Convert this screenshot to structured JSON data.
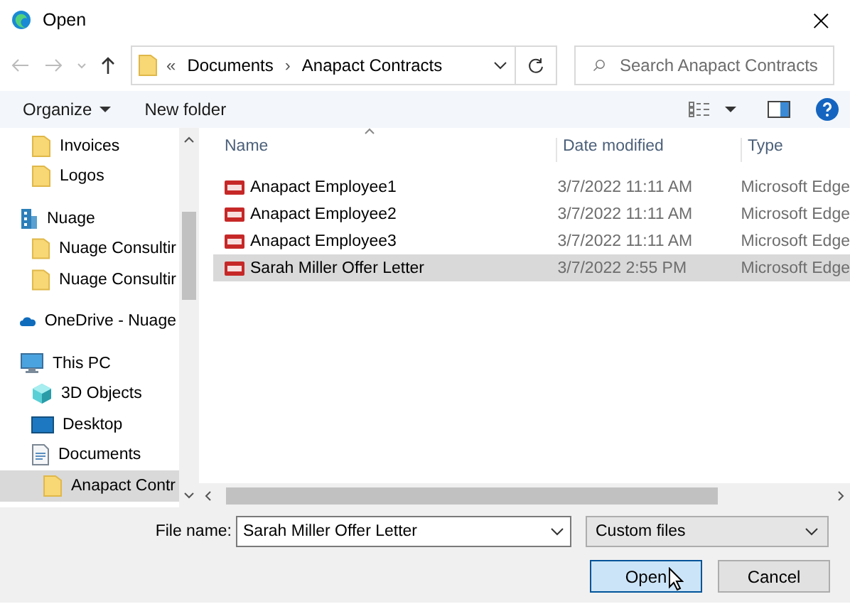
{
  "window": {
    "title": "Open",
    "close": "×"
  },
  "address": {
    "overflow": "«",
    "crumbs": [
      "Documents",
      "Anapact Contracts"
    ],
    "separator": "›"
  },
  "search": {
    "placeholder": "Search Anapact Contracts"
  },
  "toolbar": {
    "organize": "Organize",
    "new_folder": "New folder"
  },
  "sidebar": {
    "items": [
      {
        "children": [
          {
            "label": "Invoices",
            "kind": "folder",
            "selected": false
          },
          {
            "label": "Logos",
            "kind": "folder",
            "selected": false
          }
        ]
      },
      {
        "label": "Nuage",
        "kind": "network",
        "selected": false,
        "children": [
          {
            "label": "Nuage Consultir",
            "kind": "folder",
            "selected": false
          },
          {
            "label": "Nuage Consultir",
            "kind": "folder",
            "selected": false
          }
        ]
      },
      {
        "label": "OneDrive - Nuage",
        "kind": "cloud",
        "selected": false
      },
      {
        "label": "This PC",
        "kind": "pc",
        "selected": false,
        "children": [
          {
            "label": "3D Objects",
            "kind": "objects3d",
            "selected": false
          },
          {
            "label": "Desktop",
            "kind": "desktop",
            "selected": false
          },
          {
            "label": "Documents",
            "kind": "documents",
            "selected": false,
            "children": [
              {
                "label": "Anapact Contr",
                "kind": "folder",
                "selected": true
              }
            ]
          }
        ]
      }
    ]
  },
  "table": {
    "columns": [
      "Name",
      "Date modified",
      "Type"
    ],
    "rows": [
      {
        "name": "Anapact Employee1",
        "date": "3/7/2022 11:11 AM",
        "type": "Microsoft Edge",
        "selected": false
      },
      {
        "name": "Anapact Employee2",
        "date": "3/7/2022 11:11 AM",
        "type": "Microsoft Edge",
        "selected": false
      },
      {
        "name": "Anapact Employee3",
        "date": "3/7/2022 11:11 AM",
        "type": "Microsoft Edge",
        "selected": false
      },
      {
        "name": "Sarah Miller Offer Letter",
        "date": "3/7/2022 2:55 PM",
        "type": "Microsoft Edge",
        "selected": true
      }
    ]
  },
  "footer": {
    "file_name_label": "File name:",
    "file_name": "Sarah Miller Offer Letter",
    "file_type": "Custom files",
    "buttons": [
      "Open",
      "Cancel"
    ]
  }
}
